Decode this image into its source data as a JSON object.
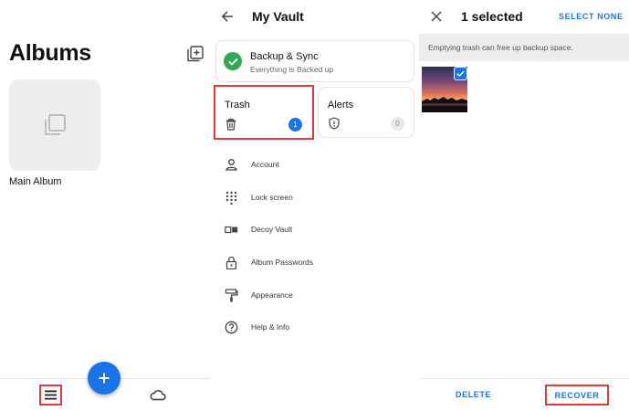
{
  "albums_screen": {
    "title": "Albums",
    "albums": [
      {
        "name": "Main Album"
      }
    ]
  },
  "vault_screen": {
    "title": "My Vault",
    "sync": {
      "title": "Backup & Sync",
      "status": "Everything is Backed up"
    },
    "trash": {
      "label": "Trash",
      "count": "1"
    },
    "alerts": {
      "label": "Alerts",
      "count": "0"
    },
    "menu": [
      {
        "label": "Account",
        "icon": "person-icon"
      },
      {
        "label": "Lock screen",
        "icon": "keypad-icon"
      },
      {
        "label": "Decoy Vault",
        "icon": "decoy-icon"
      },
      {
        "label": "Album Passwords",
        "icon": "lock-icon"
      },
      {
        "label": "Appearance",
        "icon": "paint-roller-icon"
      },
      {
        "label": "Help & Info",
        "icon": "help-icon"
      }
    ]
  },
  "trash_screen": {
    "title": "1 selected",
    "select_none": "SELECT NONE",
    "info": "Emptying trash can free up backup space.",
    "delete": "DELETE",
    "recover": "RECOVER"
  },
  "colors": {
    "accent": "#1a73e8",
    "success": "#34a853",
    "highlight": "#e53935"
  }
}
